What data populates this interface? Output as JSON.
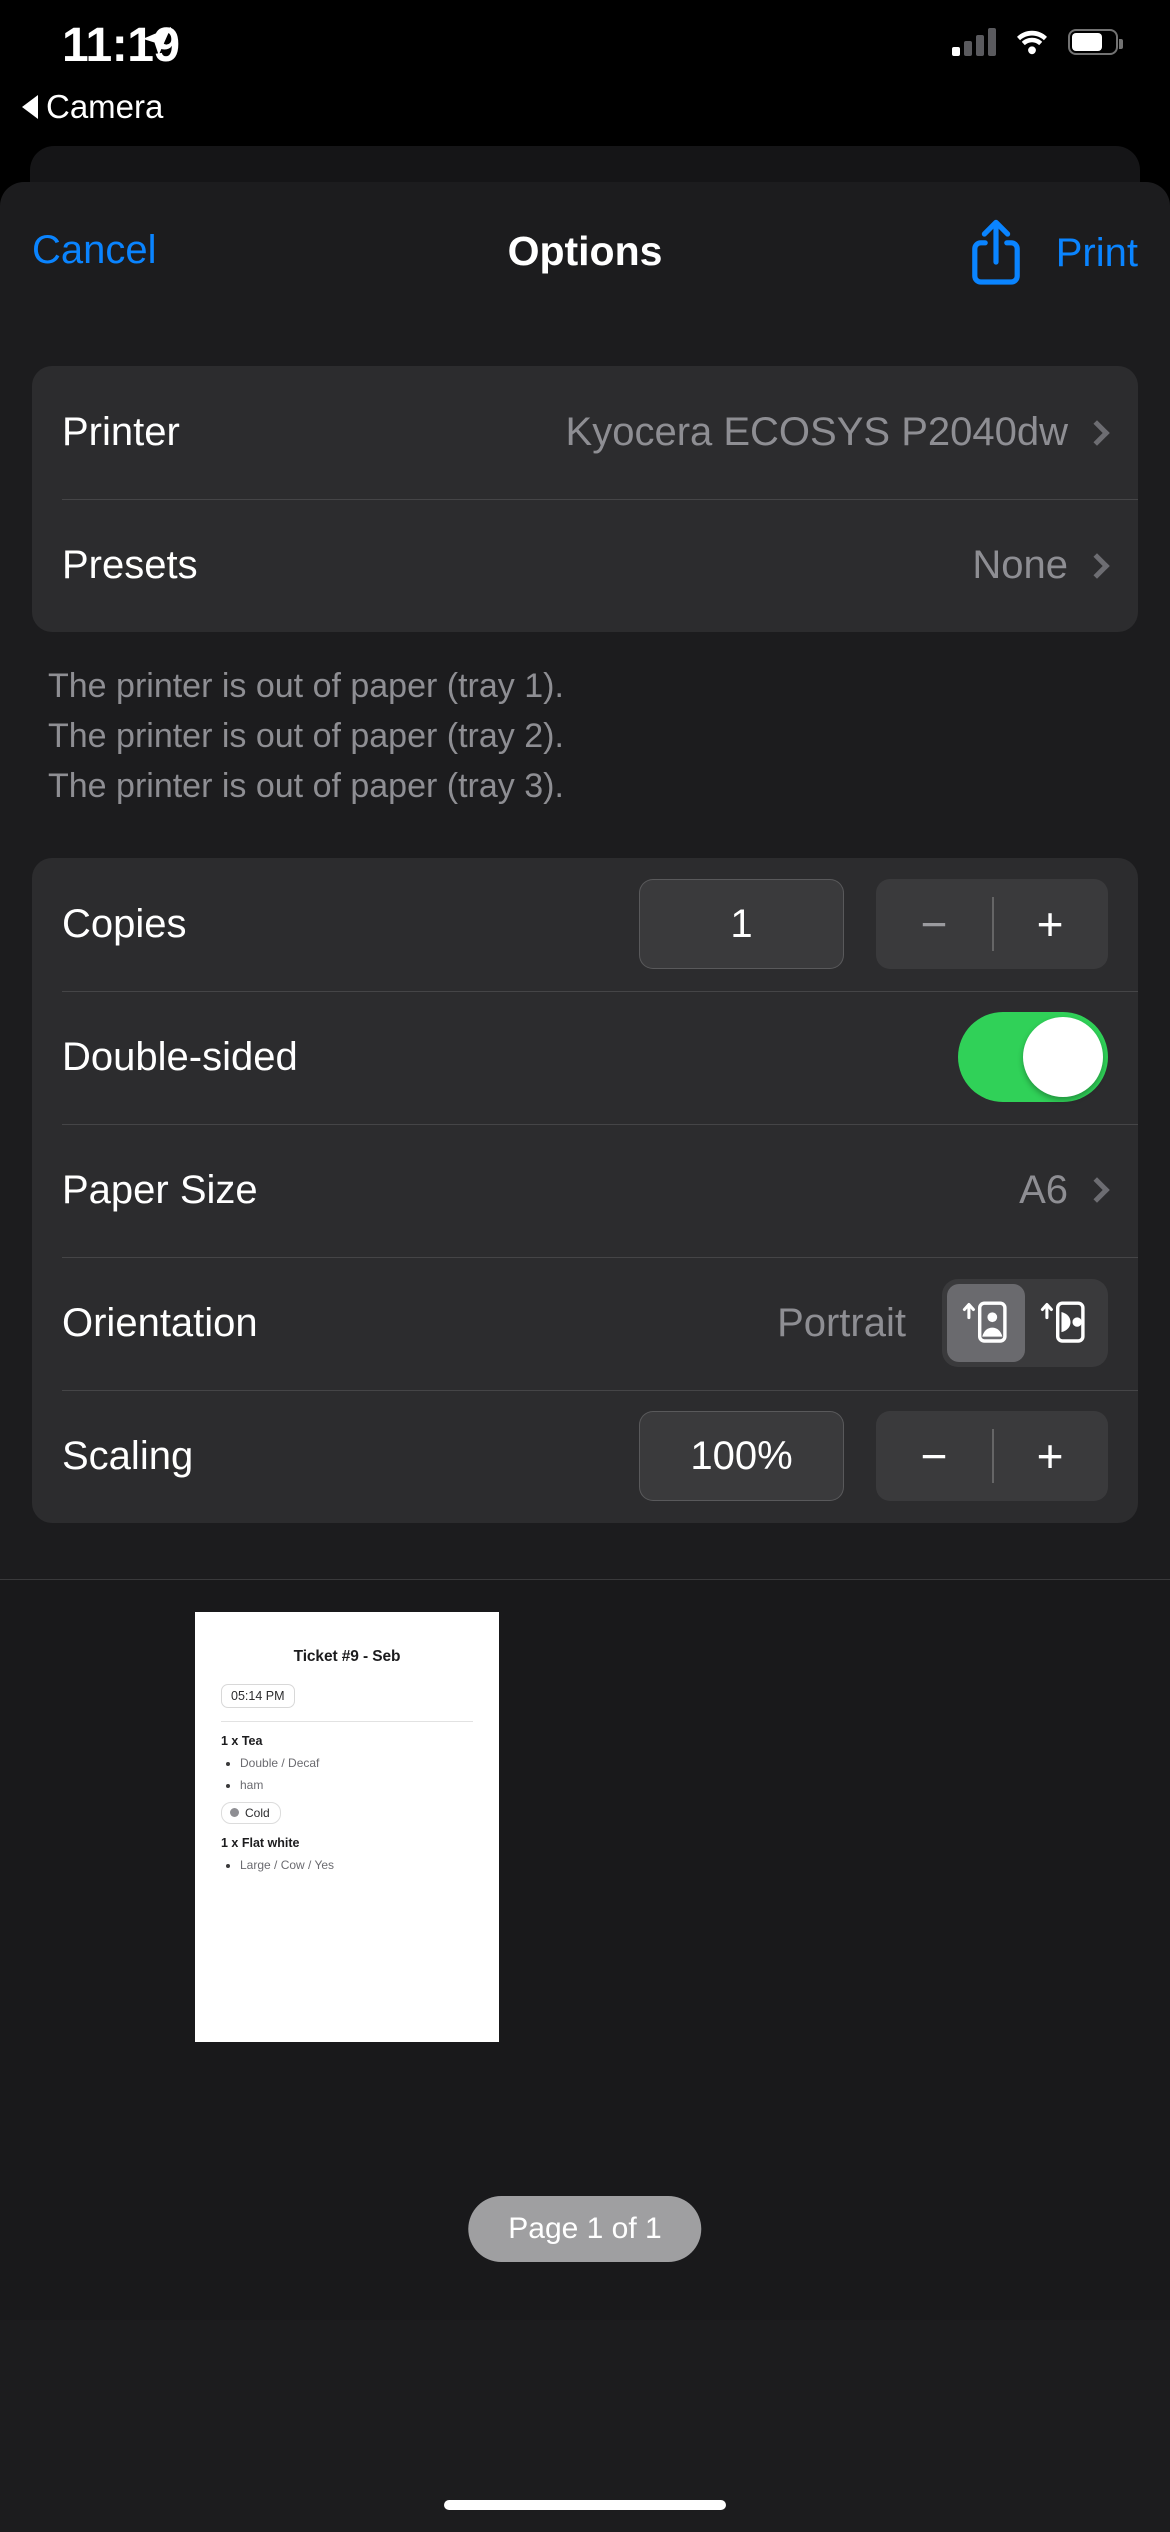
{
  "status_bar": {
    "time": "11:19",
    "location_icon": "location-arrow-icon",
    "back_label": "Camera",
    "signal_icon": "cellular-signal-icon",
    "signal_bars_filled": 1,
    "wifi_icon": "wifi-icon",
    "battery_icon": "battery-icon"
  },
  "navbar": {
    "cancel_label": "Cancel",
    "title": "Options",
    "share_icon": "share-icon",
    "print_label": "Print",
    "accent_color": "#0a84ff"
  },
  "printer_card": {
    "rows": [
      {
        "label": "Printer",
        "value": "Kyocera ECOSYS P2040dw",
        "chevron": true
      },
      {
        "label": "Presets",
        "value": "None",
        "chevron": true
      }
    ]
  },
  "status_messages": [
    "The printer is out of paper (tray 1).",
    "The printer is out of paper (tray 2).",
    "The printer is out of paper (tray 3)."
  ],
  "settings_card": {
    "copies": {
      "label": "Copies",
      "value": "1",
      "minus_label": "−",
      "plus_label": "+",
      "minus_disabled": true
    },
    "double_sided": {
      "label": "Double-sided",
      "state": "on",
      "on_color": "#30d158"
    },
    "paper_size": {
      "label": "Paper Size",
      "value": "A6",
      "chevron": true
    },
    "orientation": {
      "label": "Orientation",
      "value": "Portrait",
      "options": [
        {
          "icon": "orientation-portrait-icon",
          "selected": true
        },
        {
          "icon": "orientation-landscape-icon",
          "selected": false
        }
      ]
    },
    "scaling": {
      "label": "Scaling",
      "value": "100%",
      "minus_label": "−",
      "plus_label": "+",
      "minus_disabled": false
    }
  },
  "preview": {
    "ticket_title": "Ticket #9 - Seb",
    "ticket_time": "05:14 PM",
    "items": [
      {
        "name": "1 x Tea",
        "options": [
          "Double / Decaf",
          "ham"
        ],
        "chip": "Cold"
      },
      {
        "name": "1 x Flat white",
        "options": [
          "Large / Cow / Yes"
        ],
        "chip": null
      }
    ],
    "page_badge": "Page 1 of 1"
  }
}
